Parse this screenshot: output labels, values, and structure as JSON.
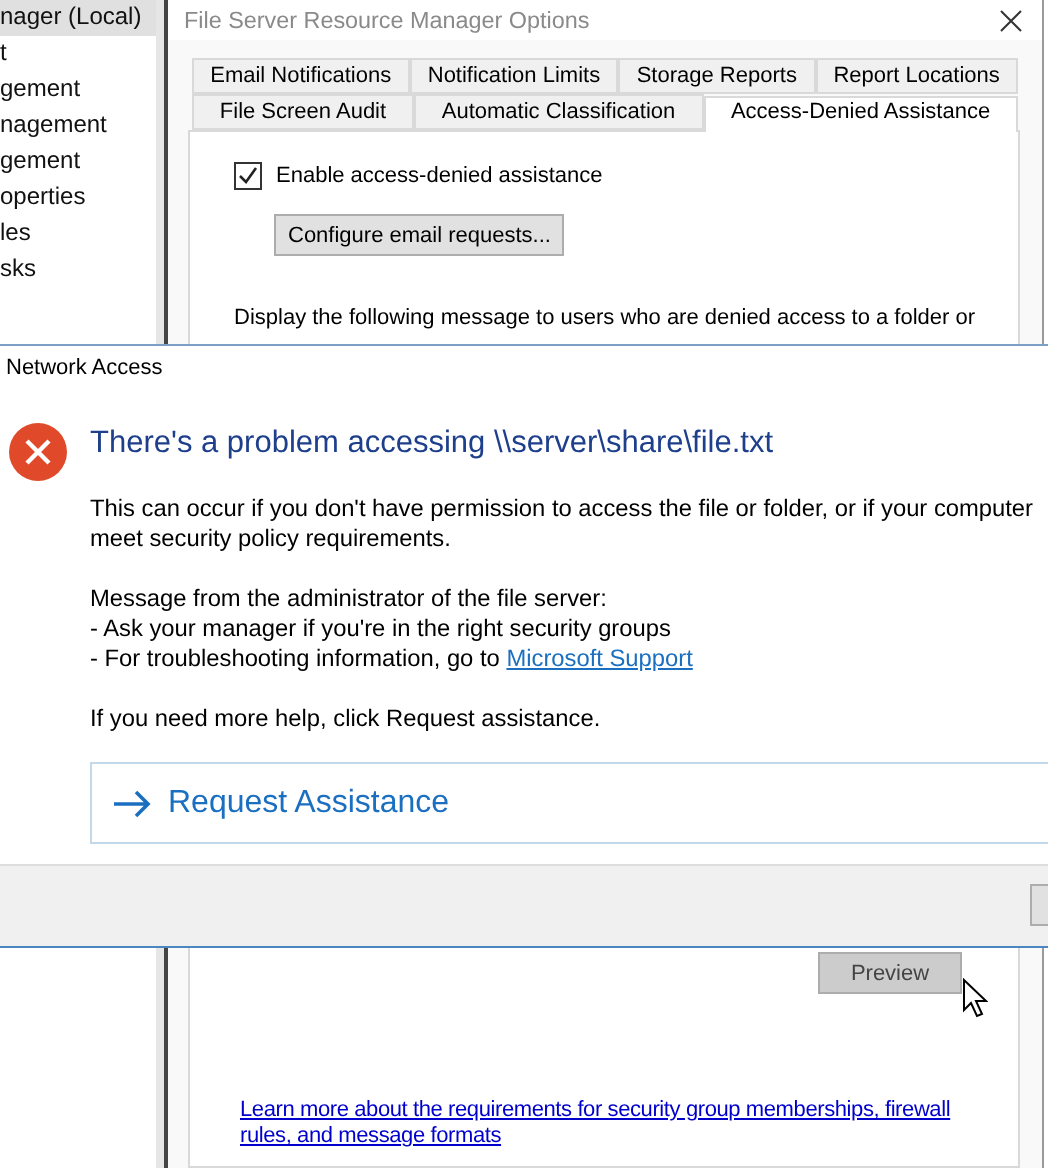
{
  "sidebar": {
    "items": [
      {
        "label": "nager (Local)",
        "selected": true
      },
      {
        "label": "t",
        "selected": false
      },
      {
        "label": "gement",
        "selected": false
      },
      {
        "label": "nagement",
        "selected": false
      },
      {
        "label": "gement",
        "selected": false
      },
      {
        "label": "operties",
        "selected": false
      },
      {
        "label": "les",
        "selected": false
      },
      {
        "label": "sks",
        "selected": false
      }
    ]
  },
  "options_dialog": {
    "title": "File Server Resource Manager Options",
    "tab_rows": [
      [
        {
          "label": "Email Notifications",
          "selected": false
        },
        {
          "label": "Notification Limits",
          "selected": false
        },
        {
          "label": "Storage Reports",
          "selected": false
        },
        {
          "label": "Report Locations",
          "selected": false
        }
      ],
      [
        {
          "label": "File Screen Audit",
          "selected": false
        },
        {
          "label": "Automatic Classification",
          "selected": false
        },
        {
          "label": "Access-Denied Assistance",
          "selected": true
        }
      ]
    ],
    "enable_checkbox": {
      "label": "Enable access-denied assistance",
      "checked": true
    },
    "configure_button": "Configure email requests...",
    "message_prompt": "Display the following message to users who are denied access to a folder or",
    "preview_button": "Preview",
    "help_link": [
      "Learn more about the requirements for security group memberships, firewall",
      "rules, and message formats"
    ]
  },
  "network_dialog": {
    "title": "Network Access",
    "heading": "There's a problem accessing \\\\server\\share\\file.txt",
    "explanation": [
      "This can occur if you don't have permission to access the file or folder, or if your computer",
      "meet security policy requirements."
    ],
    "admin_message": {
      "intro": "Message from the administrator of the file server:",
      "line": "- Ask your manager if you're in the right security groups",
      "link_line": "- For troubleshooting information, go to",
      "link": "Microsoft Support"
    },
    "help_text": "If you need more help, click Request assistance.",
    "request_button": "Request Assistance"
  }
}
